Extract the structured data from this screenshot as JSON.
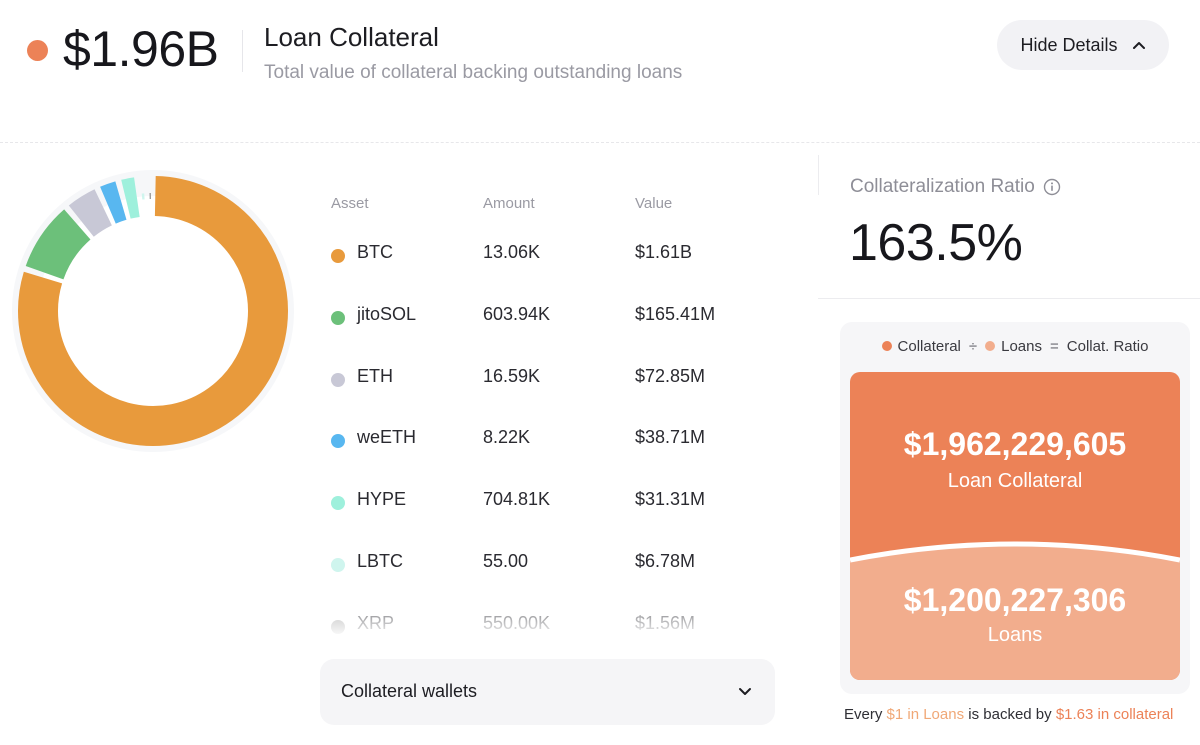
{
  "header": {
    "total_value": "$1.96B",
    "title": "Loan Collateral",
    "subtitle": "Total value of collateral backing outstanding loans",
    "toggle_label": "Hide Details",
    "accent_color": "#ec8257"
  },
  "table": {
    "columns": [
      "Asset",
      "Amount",
      "Value"
    ],
    "rows": [
      {
        "asset": "BTC",
        "amount": "13.06K",
        "value": "$1.61B",
        "color": "#e89a3c"
      },
      {
        "asset": "jitoSOL",
        "amount": "603.94K",
        "value": "$165.41M",
        "color": "#6cc07a"
      },
      {
        "asset": "ETH",
        "amount": "16.59K",
        "value": "$72.85M",
        "color": "#c8c8d6"
      },
      {
        "asset": "weETH",
        "amount": "8.22K",
        "value": "$38.71M",
        "color": "#58b7f0"
      },
      {
        "asset": "HYPE",
        "amount": "704.81K",
        "value": "$31.31M",
        "color": "#9ef0dc"
      },
      {
        "asset": "LBTC",
        "amount": "55.00",
        "value": "$6.78M",
        "color": "#cff5ee"
      },
      {
        "asset": "XRP",
        "amount": "550.00K",
        "value": "$1.56M",
        "color": "#9b9b9b"
      }
    ]
  },
  "wallets": {
    "label": "Collateral wallets"
  },
  "ratio": {
    "label": "Collateralization Ratio",
    "value": "163.5%"
  },
  "card": {
    "legend": {
      "collateral": "Collateral",
      "divide": "÷",
      "loans": "Loans",
      "equals": "=",
      "result": "Collat. Ratio"
    },
    "collateral_color": "#ec8257",
    "loans_color": "#f2ad8d",
    "collateral_amount": "$1,962,229,605",
    "collateral_label": "Loan Collateral",
    "loans_amount": "$1,200,227,306",
    "loans_label": "Loans"
  },
  "footer": {
    "part1": "Every ",
    "highlight1": "$1 in Loans",
    "part2": " is backed by ",
    "highlight2": "$1.63 in collateral"
  }
}
